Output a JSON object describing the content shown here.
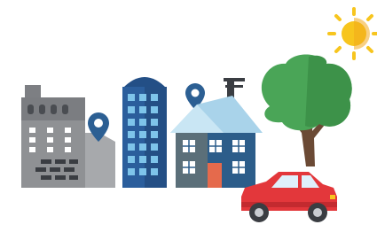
{
  "scene": {
    "background": "#ffffff",
    "elements": [
      "sun-icon",
      "factory-building",
      "office-tower",
      "house",
      "tree",
      "car",
      "location-pin-icon"
    ],
    "colors": {
      "sun": "#f7c51e",
      "factory": "#8f9194",
      "factory_dark": "#4a4d52",
      "tower": "#2b5e9c",
      "tower_windows": "#7ec4ea",
      "house_roof": "#a9d3ea",
      "house_wall": "#2c5d8a",
      "door": "#e56a4c",
      "tree_leaves": "#4aa557",
      "tree_trunk": "#6b4a35",
      "car": "#e3373b",
      "pin": "#2c5f93"
    }
  }
}
